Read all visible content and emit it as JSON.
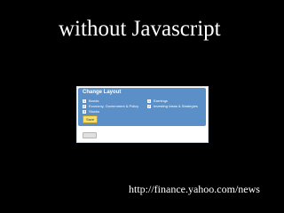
{
  "slide": {
    "title": "without Javascript",
    "link": "http://finance.yahoo.com/news"
  },
  "change_layout": {
    "title": "Change Layout",
    "left_items": [
      {
        "num": "1",
        "label": "Bonds"
      },
      {
        "num": "2",
        "label": "Economy, Government & Policy"
      },
      {
        "num": "3",
        "label": "Stocks"
      }
    ],
    "right_items": [
      {
        "num": "1",
        "label": "Earnings"
      },
      {
        "num": "2",
        "label": "Investing Ideas & Strategies"
      }
    ],
    "save_label": "Save"
  },
  "colors": {
    "slide_background": "#000000",
    "panel": "#5a8fc8",
    "save_button": "#f5df6a"
  }
}
